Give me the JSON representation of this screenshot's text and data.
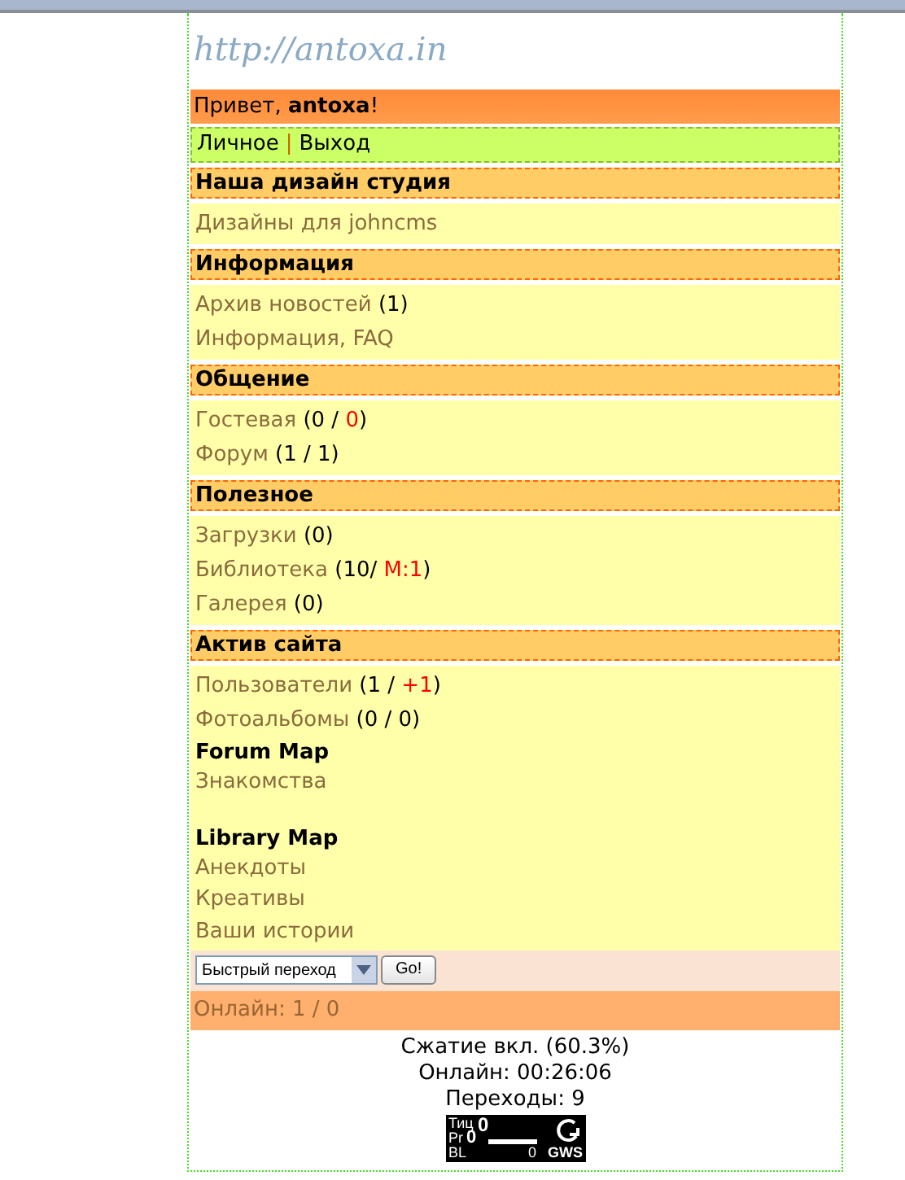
{
  "logo": "http://antoxa.in",
  "greeting": "Привет, **antoxa**!",
  "user_links": {
    "items": [
      "Личное",
      "Выход"
    ],
    "separator": "|"
  },
  "sections": [
    {
      "title": "Наша дизайн студия",
      "items": [
        {
          "label": "Дизайны для johncms"
        }
      ]
    },
    {
      "title": "Информация",
      "items": [
        {
          "label": "Архив новостей",
          "counts": [
            {
              "text": "(1)",
              "highlight": false
            }
          ]
        },
        {
          "label": "Информация, FAQ"
        }
      ]
    },
    {
      "title": "Общение",
      "items": [
        {
          "label": "Гостевая",
          "counts": [
            {
              "text": "(0 / ",
              "highlight": false
            },
            {
              "text": "0",
              "highlight": true
            },
            {
              "text": ")",
              "highlight": false
            }
          ]
        },
        {
          "label": "Форум",
          "counts": [
            {
              "text": "(1 / 1)",
              "highlight": false
            }
          ]
        }
      ]
    },
    {
      "title": "Полезное",
      "items": [
        {
          "label": "Загрузки",
          "counts": [
            {
              "text": "(0)",
              "highlight": false
            }
          ]
        },
        {
          "label": "Библиотека",
          "counts": [
            {
              "text": "(10/ ",
              "highlight": false
            },
            {
              "text": "М:1",
              "highlight": true
            },
            {
              "text": ")",
              "highlight": false
            }
          ]
        },
        {
          "label": "Галерея",
          "counts": [
            {
              "text": "(0)",
              "highlight": false
            }
          ]
        }
      ]
    },
    {
      "title": "Актив сайта",
      "items": [
        {
          "label": "Пользователи",
          "counts": [
            {
              "text": "(1 / ",
              "highlight": false
            },
            {
              "text": "+1",
              "highlight": true
            },
            {
              "text": ")",
              "highlight": false
            }
          ]
        },
        {
          "label": "Фотоальбомы",
          "counts": [
            {
              "text": "(0 / 0)",
              "highlight": false
            }
          ]
        }
      ],
      "maps": [
        {
          "title": "Forum Map",
          "links": [
            "Знакомства"
          ]
        },
        {
          "title": "Library Map",
          "links": [
            "Анекдоты",
            "Креативы",
            "Ваши истории"
          ]
        }
      ]
    }
  ],
  "quick_jump": {
    "value": "Быстрый переход",
    "button": "Go!"
  },
  "online": "Онлайн: 1 / 0",
  "footer": [
    "Сжатие вкл. (60.3%)",
    "Онлайн: 00:26:06",
    "Переходы: 9"
  ],
  "counter": {
    "tic": "Тиц",
    "tic_value": "0",
    "pr": "Pr",
    "pr_value": "0",
    "bl": "BL",
    "bl_value": "0",
    "brand": "GWS"
  }
}
